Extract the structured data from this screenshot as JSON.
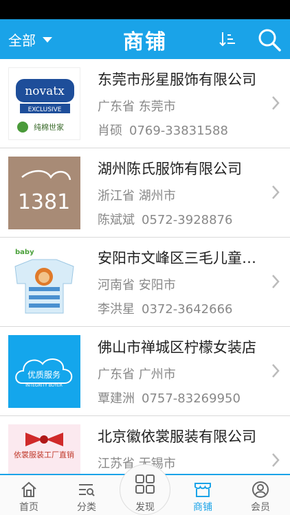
{
  "topbar": {
    "filter_label": "全部",
    "title": "商铺"
  },
  "stores": [
    {
      "name": "东莞市彤星服饰有限公司",
      "province": "广东省",
      "city": "东莞市",
      "contact": "肖硕",
      "phone": "0769-33831588",
      "logo_text": "novatx",
      "logo_sub": "EXCLUSIVE",
      "logo_tag": "纯棉世家"
    },
    {
      "name": "湖州陈氏服饰有限公司",
      "province": "浙江省",
      "city": "湖州市",
      "contact": "陈斌斌",
      "phone": "0572-3928876",
      "logo_text": "1381"
    },
    {
      "name": "安阳市文峰区三毛儿童服装店",
      "province": "河南省",
      "city": "安阳市",
      "contact": "李洪星",
      "phone": "0372-3642666",
      "logo_text": "baby"
    },
    {
      "name": "佛山市禅城区柠檬女装店",
      "province": "广东省",
      "city": "广州市",
      "contact": "覃建洲",
      "phone": "0757-83269950",
      "logo_text": "优质服务",
      "logo_sub": "INTEGRITY BUYER"
    },
    {
      "name": "北京徽依裳服装有限公司",
      "province": "江苏省",
      "city": "无锡市",
      "contact": "",
      "phone": "",
      "logo_text": "依裳服装工厂直销"
    }
  ],
  "tabs": [
    {
      "label": "首页",
      "icon": "home-icon"
    },
    {
      "label": "分类",
      "icon": "category-icon"
    },
    {
      "label": "发现",
      "icon": "grid-icon"
    },
    {
      "label": "商铺",
      "icon": "store-icon"
    },
    {
      "label": "会员",
      "icon": "user-icon"
    }
  ],
  "colors": {
    "accent": "#1aa3e8",
    "text": "#222222",
    "muted": "#888888"
  }
}
